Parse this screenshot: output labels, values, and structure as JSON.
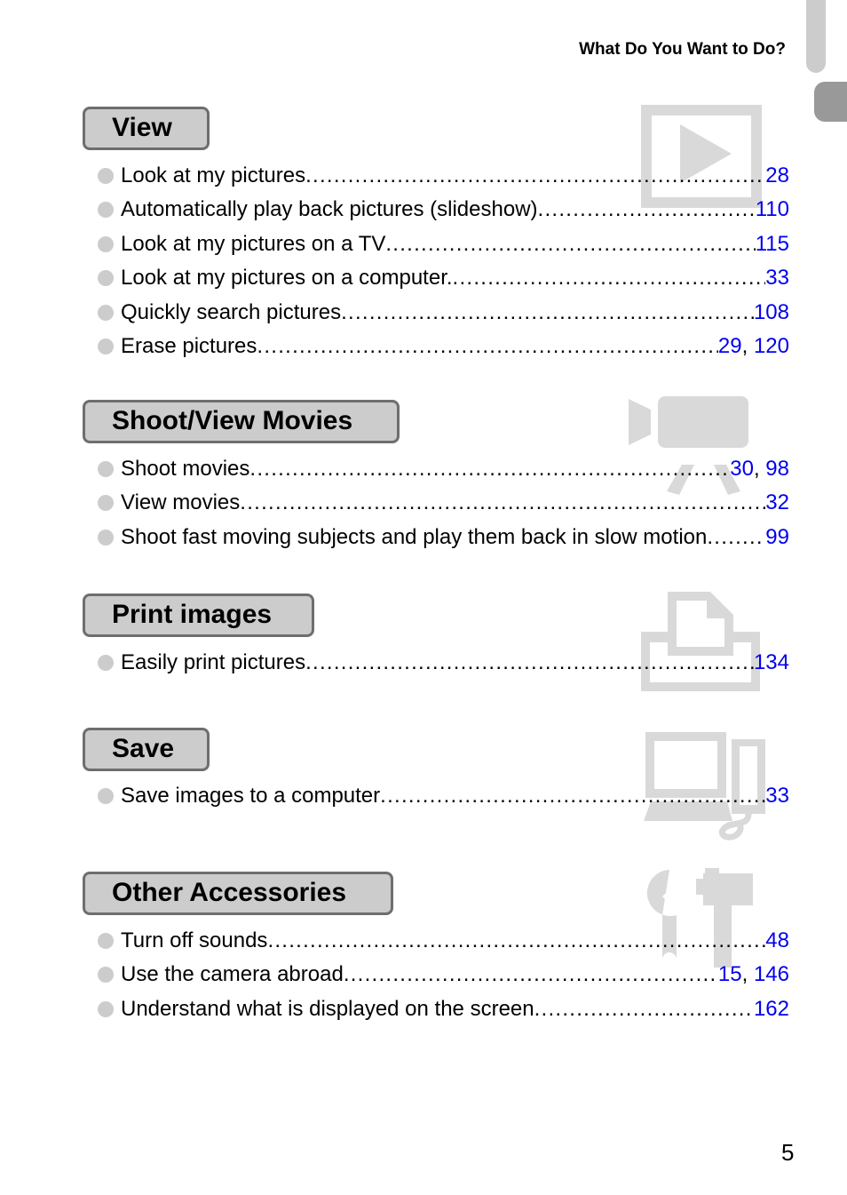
{
  "header": {
    "running_title": "What Do You Want to Do?"
  },
  "colors": {
    "link": "#0000ee",
    "header_fill": "#cccccc",
    "header_border": "#6e6e6e",
    "watermark": "#d9d9d9",
    "bullet": "#cccccc"
  },
  "sections": [
    {
      "title": "View",
      "icon": "play-icon",
      "entries": [
        {
          "label": "Look at my pictures",
          "pages": [
            "28"
          ]
        },
        {
          "label": "Automatically play back pictures (slideshow)",
          "pages": [
            "110"
          ]
        },
        {
          "label": "Look at my pictures on a TV",
          "pages": [
            "115"
          ]
        },
        {
          "label": "Look at my pictures on a computer.",
          "pages": [
            "33"
          ]
        },
        {
          "label": "Quickly search pictures",
          "pages": [
            "108"
          ]
        },
        {
          "label": "Erase pictures",
          "pages": [
            "29",
            "120"
          ]
        }
      ]
    },
    {
      "title": "Shoot/View Movies",
      "icon": "movie-camera-icon",
      "entries": [
        {
          "label": "Shoot movies",
          "pages": [
            "30",
            "98"
          ]
        },
        {
          "label": "View movies",
          "pages": [
            "32"
          ]
        },
        {
          "label": "Shoot fast moving subjects and play them back in slow motion",
          "pages": [
            "99"
          ]
        }
      ]
    },
    {
      "title": "Print images",
      "icon": "printer-icon",
      "entries": [
        {
          "label": "Easily print pictures",
          "pages": [
            "134"
          ]
        }
      ]
    },
    {
      "title": "Save",
      "icon": "computer-icon",
      "entries": [
        {
          "label": "Save images to a computer",
          "pages": [
            "33"
          ]
        }
      ]
    },
    {
      "title": "Other Accessories",
      "icon": "tools-icon",
      "entries": [
        {
          "label": "Turn off sounds",
          "pages": [
            "48"
          ]
        },
        {
          "label": "Use the camera abroad",
          "pages": [
            "15",
            "146"
          ]
        },
        {
          "label": "Understand what is displayed on the screen",
          "pages": [
            "162"
          ]
        }
      ]
    }
  ],
  "footer": {
    "page_number": "5"
  }
}
